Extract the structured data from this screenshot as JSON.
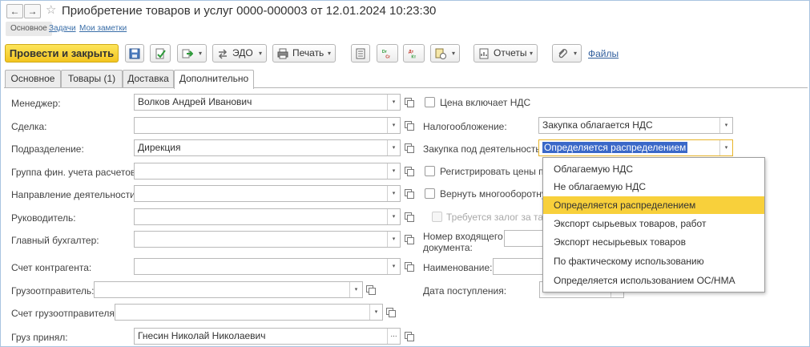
{
  "window": {
    "title": "Приобретение товаров и услуг 0000-000003 от 12.01.2024 10:23:30",
    "nav_back": "←",
    "nav_forward": "→",
    "star": "☆"
  },
  "subtabs": [
    {
      "label": "Основное"
    },
    {
      "label": "Задачи"
    },
    {
      "label": "Мои заметки"
    }
  ],
  "toolbar": {
    "post_close_label": "Провести и закрыть",
    "edo_label": "ЭДО",
    "print_label": "Печать",
    "reports_label": "Отчеты",
    "dt_cr_label": "Dr Cr",
    "files_label": "Файлы",
    "caret": "▾"
  },
  "tabs": [
    {
      "label": "Основное"
    },
    {
      "label": "Товары (1)"
    },
    {
      "label": "Доставка"
    },
    {
      "label": "Дополнительно"
    }
  ],
  "form_left": {
    "manager": {
      "label": "Менеджер:",
      "value": "Волков Андрей Иванович"
    },
    "deal": {
      "label": "Сделка:",
      "value": ""
    },
    "department": {
      "label": "Подразделение:",
      "value": "Дирекция"
    },
    "fin_group": {
      "label": "Группа фин. учета расчетов:",
      "value": ""
    },
    "activity_direction": {
      "label": "Направление деятельности:",
      "value": ""
    },
    "head": {
      "label": "Руководитель:",
      "value": ""
    },
    "chief_accountant": {
      "label": "Главный бухгалтер:",
      "value": ""
    },
    "counterparty_account": {
      "label": "Счет контрагента:",
      "value": ""
    },
    "consignor": {
      "label": "Грузоотправитель:",
      "value": ""
    },
    "consignor_account": {
      "label": "Счет грузоотправителя:",
      "value": ""
    },
    "received_by": {
      "label": "Груз принял:",
      "value": "Гнесин Николай Николаевич"
    }
  },
  "form_right": {
    "price_incl_vat": {
      "label": "Цена включает НДС"
    },
    "taxation": {
      "label": "Налогообложение:",
      "value": "Закупка облагается НДС"
    },
    "purchase_activity": {
      "label": "Закупка под деятельность:",
      "value": "Определяется распределением"
    },
    "register_prices": {
      "label": "Регистрировать цены по"
    },
    "return_packaging": {
      "label": "Вернуть многооборотну"
    },
    "deposit_required": {
      "label": "Требуется залог за тар"
    },
    "incoming_doc_number": {
      "label_line1": "Номер входящего",
      "label_line2": "документа:"
    },
    "name": {
      "label": "Наименование:"
    },
    "receipt_date": {
      "label": "Дата поступления:"
    }
  },
  "dropdown": {
    "items": [
      {
        "label": "Облагаемую НДС"
      },
      {
        "label": "Не облагаемую НДС"
      },
      {
        "label": "Определяется распределением"
      },
      {
        "label": "Экспорт сырьевых товаров, работ"
      },
      {
        "label": "Экспорт несырьевых товаров"
      },
      {
        "label": "По фактическому использованию"
      },
      {
        "label": "Определяется использованием ОС/НМА"
      }
    ],
    "selected_index": 2
  },
  "glyphs": {
    "caret_down": "▾",
    "ellipsis": "..."
  },
  "colors": {
    "primary_button": "#f3c520",
    "selected_item": "#f8d03b",
    "link": "#2f5d9c",
    "text_selection": "#3a68c8"
  }
}
